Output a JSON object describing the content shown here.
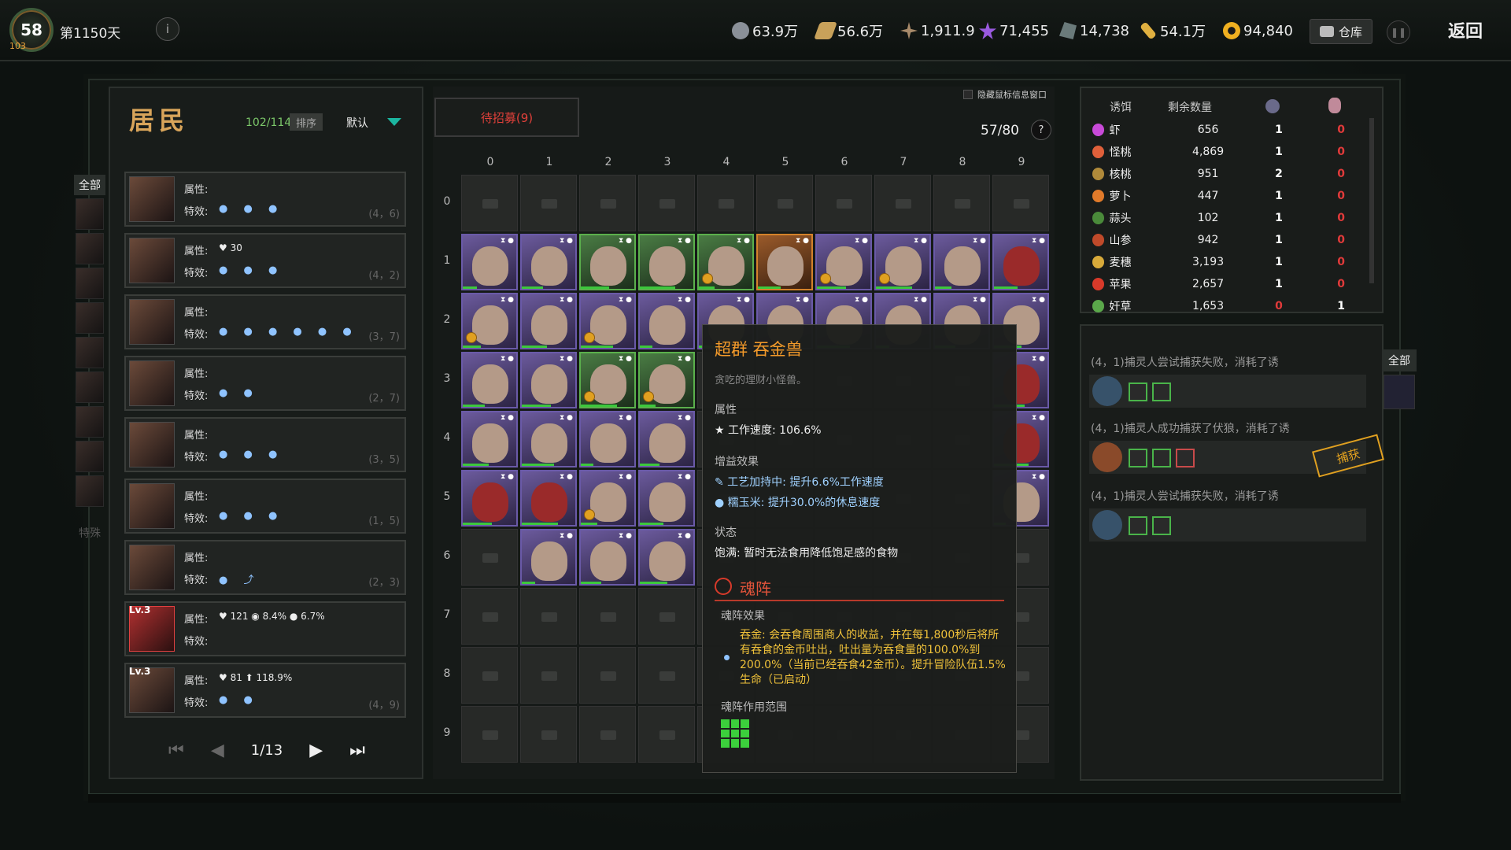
{
  "header": {
    "level": "58",
    "level_sub": "103",
    "day": "第1150天",
    "info_icon": "i",
    "resources": [
      {
        "icon": "stone-icon",
        "value": "63.9万",
        "color": "#9aa0a8"
      },
      {
        "icon": "wood-icon",
        "value": "56.6万",
        "color": "#c8a15a"
      },
      {
        "icon": "tool-icon",
        "value": "1,911.9",
        "color": "#a88a6a"
      },
      {
        "icon": "crystal-icon",
        "value": "71,455",
        "color": "#9a5ae0"
      },
      {
        "icon": "ore-icon",
        "value": "14,738",
        "color": "#6a7a7a"
      },
      {
        "icon": "scroll-icon",
        "value": "54.1万",
        "color": "#e0b040"
      },
      {
        "icon": "coin-icon",
        "value": "94,840",
        "color": "#f0b020"
      }
    ],
    "warehouse": "仓库",
    "back": "返回"
  },
  "residents": {
    "title": "居民",
    "count": "102/114",
    "sort_label": "排序",
    "sort_value": "默认",
    "cat_all": "全部",
    "cat_special": "特殊",
    "attr_label": "属性:",
    "effect_label": "特效:",
    "rows": [
      {
        "attr": "",
        "dots": "● ● ●",
        "pos": "(4，6)",
        "lv": ""
      },
      {
        "attr": "♥ 30",
        "dots": "● ● ●",
        "pos": "(4，2)",
        "lv": ""
      },
      {
        "attr": "",
        "dots": "● ● ● ● ● ●",
        "pos": "(3，7)",
        "lv": ""
      },
      {
        "attr": "",
        "dots": "● ●",
        "pos": "(2，7)",
        "lv": ""
      },
      {
        "attr": "",
        "dots": "● ● ●",
        "pos": "(3，5)",
        "lv": ""
      },
      {
        "attr": "",
        "dots": "● ● ●",
        "pos": "(1，5)",
        "lv": ""
      },
      {
        "attr": "",
        "dots": "● ⤴",
        "pos": "(2，3)",
        "lv": ""
      },
      {
        "attr": "♥ 121   ◉ 8.4%   ● 6.7%",
        "dots": "",
        "pos": "",
        "lv": "Lv.3"
      },
      {
        "attr": "♥ 81   ⬆ 118.9%",
        "dots": "● ●",
        "pos": "(4，9)",
        "lv": "Lv.3"
      }
    ],
    "pager": {
      "page": "1/13"
    }
  },
  "grid": {
    "recruit": "待招募(9)",
    "hide_tip": "隐藏鼠标信息窗口",
    "capacity": "57/80",
    "help": "?",
    "cols": [
      "0",
      "1",
      "2",
      "3",
      "4",
      "5",
      "6",
      "7",
      "8",
      "9"
    ],
    "rows": [
      "0",
      "1",
      "2",
      "3",
      "4",
      "5",
      "6",
      "7",
      "8",
      "9"
    ]
  },
  "tooltip": {
    "title": "超群 吞金兽",
    "subtitle": "贪吃的理财小怪兽。",
    "attr_header": "属性",
    "work_speed": "★ 工作速度: 106.6%",
    "buff_header": "增益效果",
    "buff1": "✎ 工艺加持中: 提升6.6%工作速度",
    "buff2": "● 糯玉米: 提升30.0%的休息速度",
    "state_header": "状态",
    "state": "饱满: 暂时无法食用降低饱足感的食物",
    "soul_header": "魂阵",
    "soul_effect_header": "魂阵效果",
    "soul_effect": "吞金: 会吞食周围商人的收益，并在每1,800秒后将所有吞食的金币吐出，吐出量为吞食量的100.0%到200.0%（当前已经吞食42金币）。提升冒险队伍1.5%生命（已启动）",
    "soul_range_header": "魂阵作用范围"
  },
  "bait": {
    "headers": {
      "bait": "诱饵",
      "remaining": "剩余数量"
    },
    "rows": [
      {
        "name": "虾",
        "qty": "656",
        "a": "1",
        "b": "0",
        "color": "#c84ad8"
      },
      {
        "name": "怪桃",
        "qty": "4,869",
        "a": "1",
        "b": "0",
        "color": "#e0603a"
      },
      {
        "name": "核桃",
        "qty": "951",
        "a": "2",
        "b": "0",
        "color": "#b08a3a"
      },
      {
        "name": "萝卜",
        "qty": "447",
        "a": "1",
        "b": "0",
        "color": "#e07a2a"
      },
      {
        "name": "蒜头",
        "qty": "102",
        "a": "1",
        "b": "0",
        "color": "#4a8a3a"
      },
      {
        "name": "山参",
        "qty": "942",
        "a": "1",
        "b": "0",
        "color": "#c04a2a"
      },
      {
        "name": "麦穗",
        "qty": "3,193",
        "a": "1",
        "b": "0",
        "color": "#d8aa3a"
      },
      {
        "name": "苹果",
        "qty": "2,657",
        "a": "1",
        "b": "0",
        "color": "#d83a2a"
      },
      {
        "name": "奸草",
        "qty": "1,653",
        "a": "0",
        "b": "1",
        "color": "#5aa84a"
      }
    ]
  },
  "log": {
    "entries": [
      {
        "text": "(4，1)捕灵人尝试捕获失败，消耗了诱"
      },
      {
        "text": "(4，1)捕灵人成功捕获了伏狼，消耗了诱"
      },
      {
        "text": "(4，1)捕灵人尝试捕获失败，消耗了诱"
      }
    ],
    "captured": "捕获",
    "cat_all": "全部"
  }
}
